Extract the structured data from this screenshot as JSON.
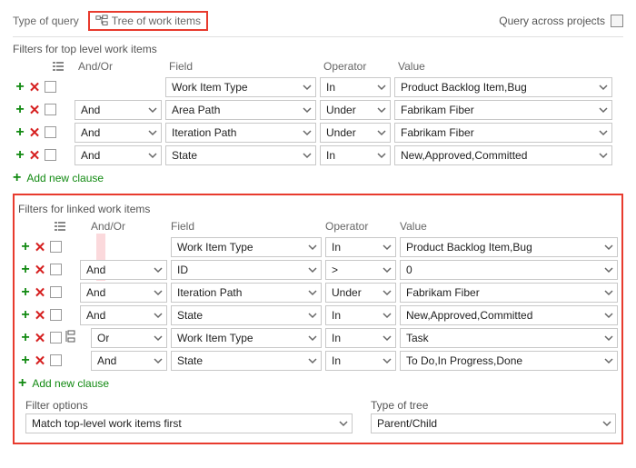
{
  "topbar": {
    "type_of_query_label": "Type of query",
    "tree_label": "Tree of work items",
    "cross_label": "Query across projects"
  },
  "top_filters": {
    "title": "Filters for top level work items",
    "headers": {
      "andor": "And/Or",
      "field": "Field",
      "operator": "Operator",
      "value": "Value"
    },
    "rows": [
      {
        "andor": "",
        "field": "Work Item Type",
        "op": "In",
        "value": "Product Backlog Item,Bug"
      },
      {
        "andor": "And",
        "field": "Area Path",
        "op": "Under",
        "value": "Fabrikam Fiber"
      },
      {
        "andor": "And",
        "field": "Iteration Path",
        "op": "Under",
        "value": "Fabrikam Fiber"
      },
      {
        "andor": "And",
        "field": "State",
        "op": "In",
        "value": "New,Approved,Committed"
      }
    ],
    "add_label": "Add new clause"
  },
  "linked_filters": {
    "title": "Filters for linked work items",
    "headers": {
      "andor": "And/Or",
      "field": "Field",
      "operator": "Operator",
      "value": "Value"
    },
    "rows": [
      {
        "andor": "",
        "field": "Work Item Type",
        "op": "In",
        "value": "Product Backlog Item,Bug",
        "group": false
      },
      {
        "andor": "And",
        "field": "ID",
        "op": ">",
        "value": "0",
        "group": false
      },
      {
        "andor": "And",
        "field": "Iteration Path",
        "op": "Under",
        "value": "Fabrikam Fiber",
        "group": false
      },
      {
        "andor": "And",
        "field": "State",
        "op": "In",
        "value": "New,Approved,Committed",
        "group": false
      },
      {
        "andor": "Or",
        "field": "Work Item Type",
        "op": "In",
        "value": "Task",
        "group": true
      },
      {
        "andor": "And",
        "field": "State",
        "op": "In",
        "value": "To Do,In Progress,Done",
        "group": true
      }
    ],
    "add_label": "Add new clause",
    "filter_options_label": "Filter options",
    "filter_options_value": "Match top-level work items first",
    "tree_type_label": "Type of tree",
    "tree_type_value": "Parent/Child"
  }
}
